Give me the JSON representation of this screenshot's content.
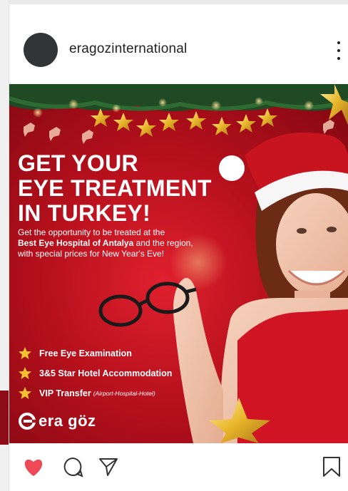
{
  "header": {
    "username": "eragozinternational"
  },
  "post": {
    "headline": [
      "GET YOUR",
      "EYE TREATMENT",
      "IN TURKEY!"
    ],
    "subtext_line1": "Get the opportunity to be treated at the",
    "subtext_bold": "Best Eye Hospital of Antalya",
    "subtext_line2_rest": " and the region,",
    "subtext_line3": "with special prices for New Year's Eve!",
    "features": [
      {
        "label": "Free Eye Examination",
        "sub": ""
      },
      {
        "label": "3&5 Star Hotel Accommodation",
        "sub": ""
      },
      {
        "label": "VIP Transfer",
        "sub": "(Airport-Hospital-Hotel)"
      }
    ],
    "logo_text": "era göz"
  },
  "actions": {
    "like_icon": "heart-icon",
    "comment_icon": "comment-icon",
    "share_icon": "send-icon",
    "save_icon": "bookmark-icon",
    "like_color": "#ed4956"
  },
  "colors": {
    "post_red": "#c0121f",
    "star_gold": "#f2c230"
  }
}
